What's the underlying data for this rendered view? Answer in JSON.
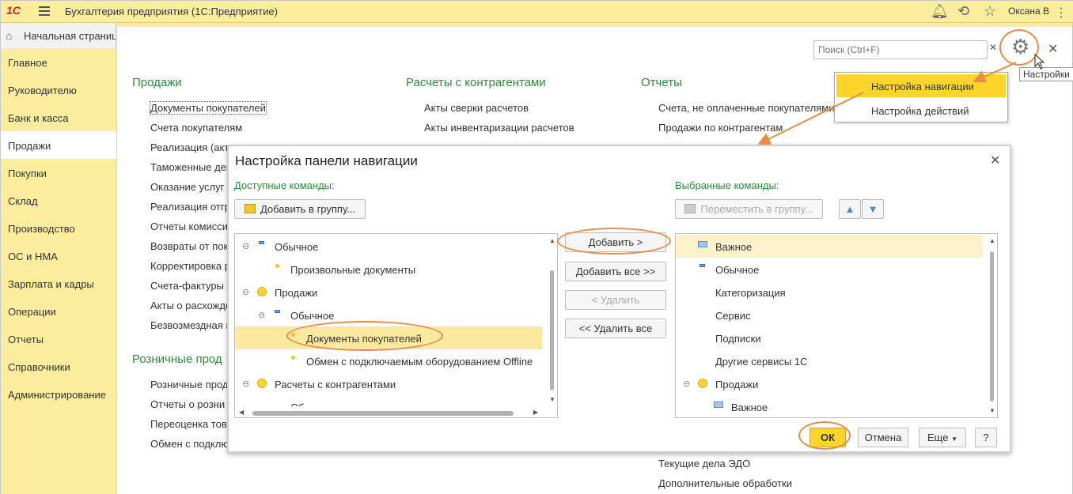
{
  "topbar": {
    "logo": "1С",
    "app_title": "Бухгалтерия предприятия   (1С:Предприятие)",
    "user": "Оксана В"
  },
  "home": {
    "label": "Начальная страница"
  },
  "sidebar": {
    "items": [
      {
        "label": "Главное"
      },
      {
        "label": "Руководителю"
      },
      {
        "label": "Банк и касса"
      },
      {
        "label": "Продажи"
      },
      {
        "label": "Покупки"
      },
      {
        "label": "Склад"
      },
      {
        "label": "Производство"
      },
      {
        "label": "ОС и НМА"
      },
      {
        "label": "Зарплата и кадры"
      },
      {
        "label": "Операции"
      },
      {
        "label": "Отчеты"
      },
      {
        "label": "Справочники"
      },
      {
        "label": "Администрирование"
      }
    ],
    "active_index": 3
  },
  "main": {
    "search_placeholder": "Поиск (Ctrl+F)",
    "settings_tooltip": "Настройки",
    "sections": {
      "sales": {
        "title": "Продажи",
        "links": [
          "Документы покупателей",
          "Счета покупателям",
          "Реализация (акт",
          "Таможенные дек",
          "Оказание услуг",
          "Реализация отгр",
          "Отчеты комисси",
          "Возвраты от пок",
          "Корректировка р",
          "Счета-фактуры в",
          "Акты о расхожде",
          "Безвозмездная п"
        ]
      },
      "retail": {
        "title": "Розничные прод",
        "links": [
          "Розничные прод",
          "Отчеты о розни",
          "Переоценка това",
          "Обмен с подклю"
        ]
      },
      "settlements": {
        "title": "Расчеты с контрагентами",
        "links": [
          "Акты сверки расчетов",
          "Акты инвентаризации расчетов"
        ]
      },
      "reports": {
        "title": "Отчеты",
        "links": [
          "Счета, не оплаченные покупателями",
          "Продажи по контрагентам"
        ],
        "bottom_links": [
          "Текущие дела ЭДО",
          "Дополнительные обработки"
        ]
      }
    }
  },
  "settings_menu": {
    "items": [
      {
        "label": "Настройка навигации"
      },
      {
        "label": "Настройка действий"
      }
    ]
  },
  "dialog": {
    "title": "Настройка панели навигации",
    "available_label": "Доступные команды:",
    "selected_label": "Выбранные команды:",
    "add_to_group": "Добавить в группу...",
    "move_to_group": "Переместить в группу...",
    "btn_add": "Добавить >",
    "btn_add_all": "Добавить все >>",
    "btn_remove": "< Удалить",
    "btn_remove_all": "<< Удалить все",
    "available_tree": [
      {
        "label": "Обычное"
      },
      {
        "label": "Произвольные документы"
      },
      {
        "label": "Продажи"
      },
      {
        "label": "Обычное"
      },
      {
        "label": "Документы покупателей"
      },
      {
        "label": "Обмен с подключаемым оборудованием Offline"
      },
      {
        "label": "Расчеты с контрагентами"
      },
      {
        "label": "Об"
      }
    ],
    "selected_tree": [
      {
        "label": "Важное"
      },
      {
        "label": "Обычное"
      },
      {
        "label": "Категоризация"
      },
      {
        "label": "Сервис"
      },
      {
        "label": "Подписки"
      },
      {
        "label": "Другие сервисы 1С"
      },
      {
        "label": "Продажи"
      },
      {
        "label": "Важное"
      }
    ],
    "ok": "ОК",
    "cancel": "Отмена",
    "more": "Еще",
    "help": "?"
  },
  "colors": {
    "sidebar_bg": "#fbed9e",
    "section_title": "#2c8c3c",
    "selection": "#fcd52c",
    "highlight_ring": "#e98d46"
  }
}
